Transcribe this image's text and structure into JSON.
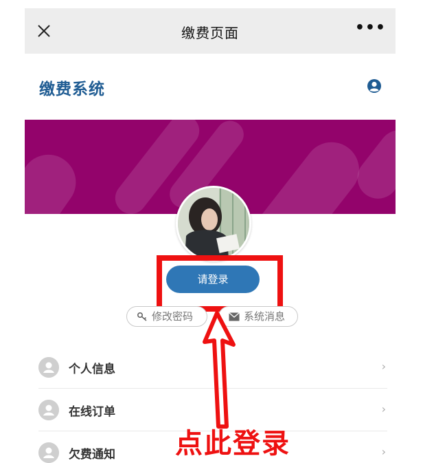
{
  "navbar": {
    "title": "缴费页面",
    "more": "•••",
    "close_icon": "close-icon"
  },
  "header": {
    "title": "缴费系统",
    "user_icon": "user-circle-icon"
  },
  "banner": {
    "color": "#93036b"
  },
  "login": {
    "button_label": "请登录"
  },
  "actions": {
    "change_password": "修改密码",
    "change_password_icon": "key-icon",
    "system_messages": "系统消息",
    "system_messages_icon": "envelope-icon"
  },
  "menu": {
    "items": [
      {
        "label": "个人信息",
        "icon": "user-icon",
        "chevron": "›"
      },
      {
        "label": "在线订单",
        "icon": "user-icon",
        "chevron": "›"
      },
      {
        "label": "欠费通知",
        "icon": "user-icon",
        "chevron": "›"
      }
    ]
  },
  "annotation": {
    "text": "点此登录",
    "color": "#ee1111"
  },
  "colors": {
    "accent": "#1f5c93",
    "button": "#2f77b6",
    "highlight": "#ee1111"
  }
}
